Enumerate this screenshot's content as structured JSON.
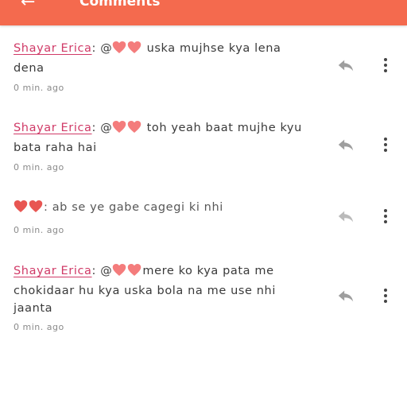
{
  "header": {
    "title": "Comments",
    "back_icon": "arrow-left-icon",
    "background": "#f46a4e"
  },
  "colors": {
    "author": "#d03a67",
    "heart_light": "#f47c7c",
    "heart_red": "#e53935"
  },
  "comments": [
    {
      "author": "Shayar Erica",
      "separator": ":",
      "mention": "@",
      "text": " uska mujhse kya lena dena",
      "time": "0 min. ago"
    },
    {
      "author": "Shayar Erica",
      "separator": ":",
      "mention": "@",
      "text": " toh yeah baat mujhe kyu bata raha hai",
      "time": "0 min. ago"
    },
    {
      "author": "",
      "separator": "",
      "mention": "",
      "text": ": ab se ye gabe cagegi ki nhi",
      "time": "0 min. ago"
    },
    {
      "author": "Shayar Erica",
      "separator": ":",
      "mention": "@",
      "text": "mere ko kya pata me chokidaar hu kya uska bola na me use nhi jaanta",
      "time": "0 min. ago"
    }
  ]
}
